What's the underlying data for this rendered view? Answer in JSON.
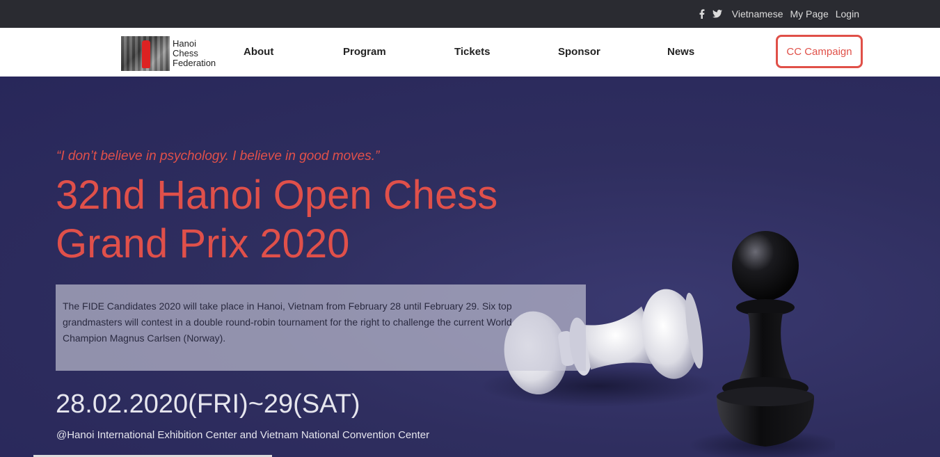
{
  "topbar": {
    "social": [
      "facebook-icon",
      "twitter-icon"
    ],
    "language": "Vietnamese",
    "mypage": "My Page",
    "login": "Login"
  },
  "nav": {
    "logo_lines": [
      "Hanoi",
      "Chess",
      "Federation"
    ],
    "items": [
      "About",
      "Program",
      "Tickets",
      "Sponsor",
      "News"
    ],
    "campaign": "CC Campaign"
  },
  "hero": {
    "quote": "“I don’t believe in psychology. I believe in good moves.”",
    "title": "32nd Hanoi Open Chess Grand Prix 2020",
    "description": "The FIDE Candidates 2020 will take place in Hanoi, Vietnam from February 28 until February 29. Six top grandmasters will contest in a double round-robin tournament for the right to challenge the current World Champion Magnus Carlsen (Norway).",
    "date": "28.02.2020(FRI)~29(SAT)",
    "venue": "@Hanoi International Exhibition Center and Vietnam National Convention Center"
  },
  "colors": {
    "accent": "#e0504a",
    "topbar_bg": "#2a2b31",
    "hero_bg": "#2d2c5c"
  }
}
